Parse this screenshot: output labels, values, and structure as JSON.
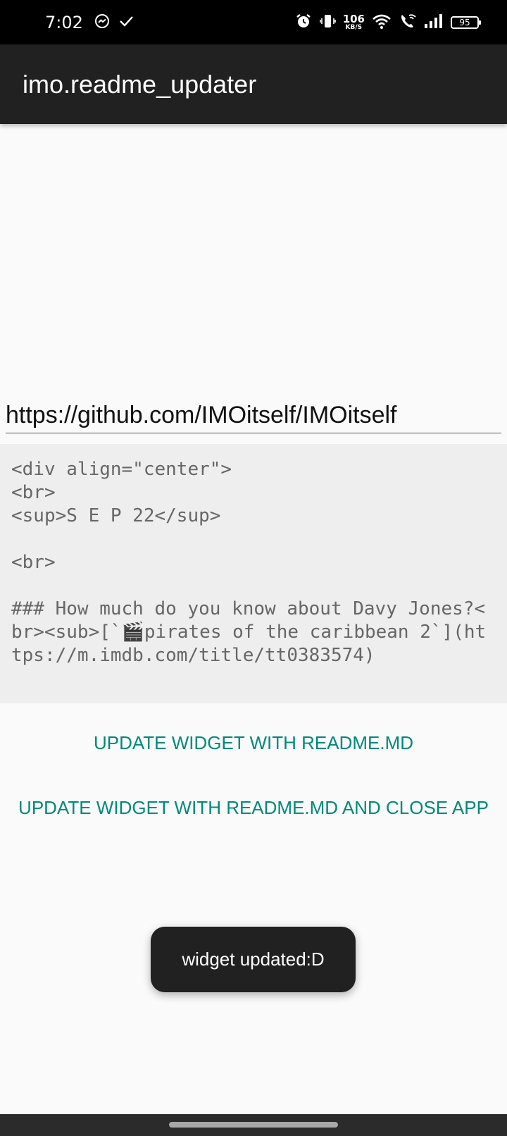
{
  "status_bar": {
    "time": "7:02",
    "speed_value": "106",
    "speed_unit": "KB/S",
    "battery": "95",
    "icons_left": [
      "messenger-icon",
      "check-icon"
    ],
    "icons_right": [
      "alarm-icon",
      "vibrate-icon",
      "wifi-icon",
      "wifi-call-icon",
      "signal-icon",
      "battery-icon"
    ]
  },
  "app_bar": {
    "title": "imo.readme_updater"
  },
  "url_input": {
    "value": "https://github.com/IMOitself/IMOitself"
  },
  "readme_preview": {
    "text": "<div align=\"center\">\n<br>\n<sup>S E P 22</sup>\n\n<br>\n\n### How much do you know about Davy Jones?<br><sub>[`🎬pirates of the caribbean 2`](https://m.imdb.com/title/tt0383574)"
  },
  "buttons": {
    "update_label": "UPDATE WIDGET WITH README.MD",
    "update_close_label": "UPDATE WIDGET WITH README.MD AND CLOSE APP"
  },
  "toast": {
    "message": "widget updated:D"
  },
  "colors": {
    "accent": "#00897b",
    "app_bar": "#212121",
    "status_bar": "#000000",
    "background": "#fafafa"
  }
}
